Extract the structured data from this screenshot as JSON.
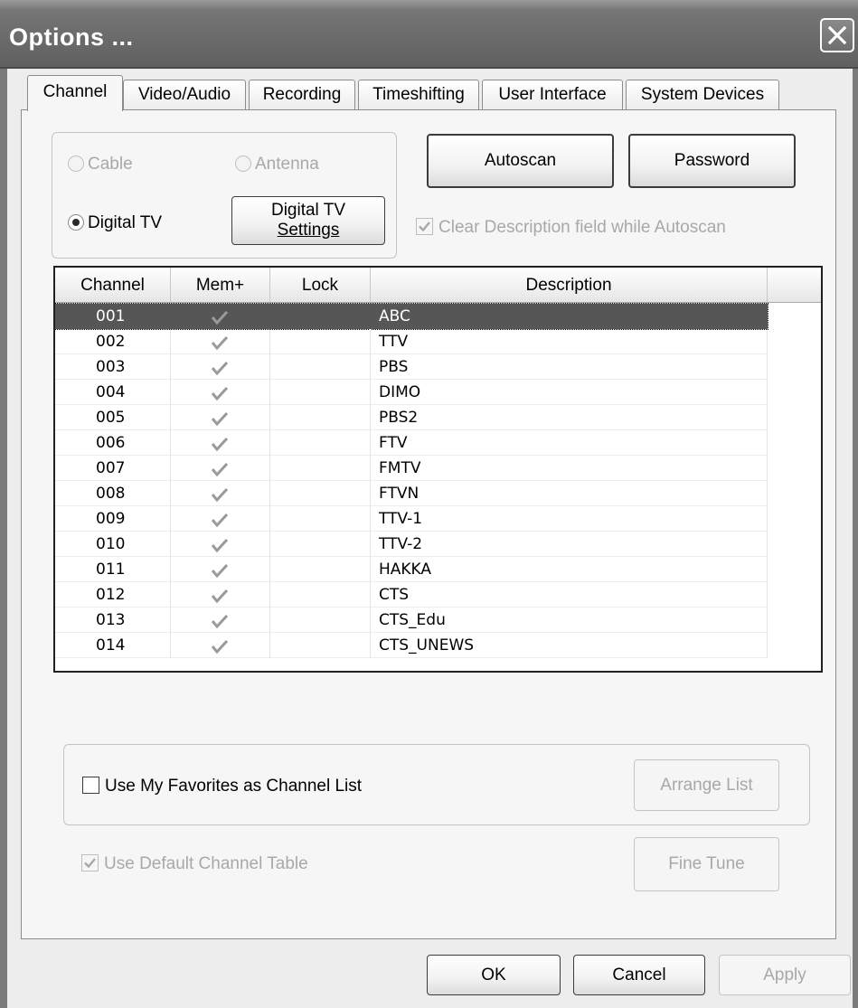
{
  "window": {
    "title": "Options ..."
  },
  "tabs": [
    {
      "label": "Channel"
    },
    {
      "label": "Video/Audio"
    },
    {
      "label": "Recording"
    },
    {
      "label": "Timeshifting"
    },
    {
      "label": "User Interface"
    },
    {
      "label": "System Devices"
    }
  ],
  "source_group": {
    "cable_label": "Cable",
    "antenna_label": "Antenna",
    "digital_tv_label": "Digital TV",
    "selected": "Digital TV",
    "digital_settings_line1": "Digital TV",
    "digital_settings_line2": "Settings"
  },
  "buttons": {
    "autoscan": "Autoscan",
    "password": "Password",
    "arrange_list": "Arrange List",
    "fine_tune": "Fine Tune",
    "ok": "OK",
    "cancel": "Cancel",
    "apply": "Apply"
  },
  "options": {
    "clear_description": "Clear Description field while Autoscan",
    "clear_description_checked": true,
    "use_favorites": "Use My Favorites as Channel List",
    "use_favorites_checked": false,
    "use_default_table": "Use Default Channel Table",
    "use_default_table_checked": true
  },
  "channel_list": {
    "columns": [
      "Channel",
      "Mem+",
      "Lock",
      "Description"
    ],
    "selected_index": 0,
    "rows": [
      {
        "channel": "001",
        "mem": true,
        "lock": false,
        "description": "ABC"
      },
      {
        "channel": "002",
        "mem": true,
        "lock": false,
        "description": "TTV"
      },
      {
        "channel": "003",
        "mem": true,
        "lock": false,
        "description": "PBS"
      },
      {
        "channel": "004",
        "mem": true,
        "lock": false,
        "description": "DIMO"
      },
      {
        "channel": "005",
        "mem": true,
        "lock": false,
        "description": "PBS2"
      },
      {
        "channel": "006",
        "mem": true,
        "lock": false,
        "description": "FTV"
      },
      {
        "channel": "007",
        "mem": true,
        "lock": false,
        "description": "FMTV"
      },
      {
        "channel": "008",
        "mem": true,
        "lock": false,
        "description": "FTVN"
      },
      {
        "channel": "009",
        "mem": true,
        "lock": false,
        "description": "TTV-1"
      },
      {
        "channel": "010",
        "mem": true,
        "lock": false,
        "description": "TTV-2"
      },
      {
        "channel": "011",
        "mem": true,
        "lock": false,
        "description": "HAKKA"
      },
      {
        "channel": "012",
        "mem": true,
        "lock": false,
        "description": "CTS"
      },
      {
        "channel": "013",
        "mem": true,
        "lock": false,
        "description": "CTS_Edu"
      },
      {
        "channel": "014",
        "mem": true,
        "lock": false,
        "description": "CTS_UNEWS"
      }
    ]
  },
  "icons": {
    "close": "close-icon",
    "check": "check-icon"
  }
}
